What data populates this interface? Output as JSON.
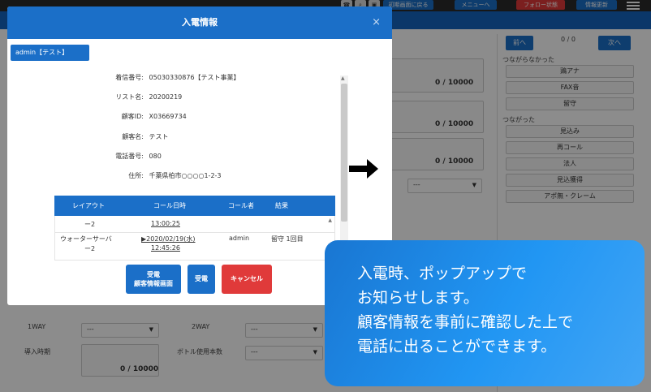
{
  "topbar": {
    "buttons": [
      "初期画面に戻る",
      "メニューへ",
      "フォロー状態",
      "情報更新"
    ]
  },
  "right_panel": {
    "prev": "前へ",
    "count": "0 / 0",
    "next": "次へ",
    "section1": "つながらなかった",
    "group1": [
      "鶏アナ",
      "FAX音",
      "留守"
    ],
    "section2": "つながった",
    "group2": [
      "見込み",
      "再コール",
      "法人",
      "見込獲得",
      "アポ無・クレーム"
    ]
  },
  "form": {
    "counter1": "0 / 10000",
    "counter2": "0 / 10000",
    "counter3": "0 / 10000",
    "select_placeholder": "---",
    "lower": {
      "label_1way": "1WAY",
      "label_2way": "2WAY",
      "label_intro": "導入時期",
      "label_bottle": "ボトル使用本数",
      "select_value": "---",
      "counter": "0 / 10000"
    }
  },
  "modal": {
    "title": "入電情報",
    "close": "×",
    "admin_tag": "admin【テスト】",
    "info": [
      {
        "label": "着信番号:",
        "value": "05030330876【テスト事業】"
      },
      {
        "label": "リスト名:",
        "value": "20200219"
      },
      {
        "label": "顧客ID:",
        "value": "X03669734"
      },
      {
        "label": "顧客名:",
        "value": "テスト"
      },
      {
        "label": "電話番号:",
        "value": "080"
      },
      {
        "label": "住所:",
        "value": "千葉県柏市○○○○1-2-3"
      }
    ],
    "history": {
      "headers": [
        "レイアウト",
        "コール日時",
        "コール者",
        "結果"
      ],
      "row1": {
        "layout": "ー2",
        "datetime": "13:00:25"
      },
      "row2": {
        "layout_line1": "ウォーターサーバ",
        "layout_line2": "ー2",
        "datetime_line1": "▶2020/02/19(水)",
        "datetime_line2": "12:45:26",
        "caller": "admin",
        "result": "留守 1回目"
      }
    },
    "buttons": {
      "answer_with_info_line1": "受電",
      "answer_with_info_line2": "顧客情報画面",
      "answer": "受電",
      "cancel": "キャンセル"
    }
  },
  "callout": {
    "line1": "入電時、ポップアップで",
    "line2": "お知らせします。",
    "line3": "顧客情報を事前に確認した上で",
    "line4": "電話に出ることができます。"
  }
}
